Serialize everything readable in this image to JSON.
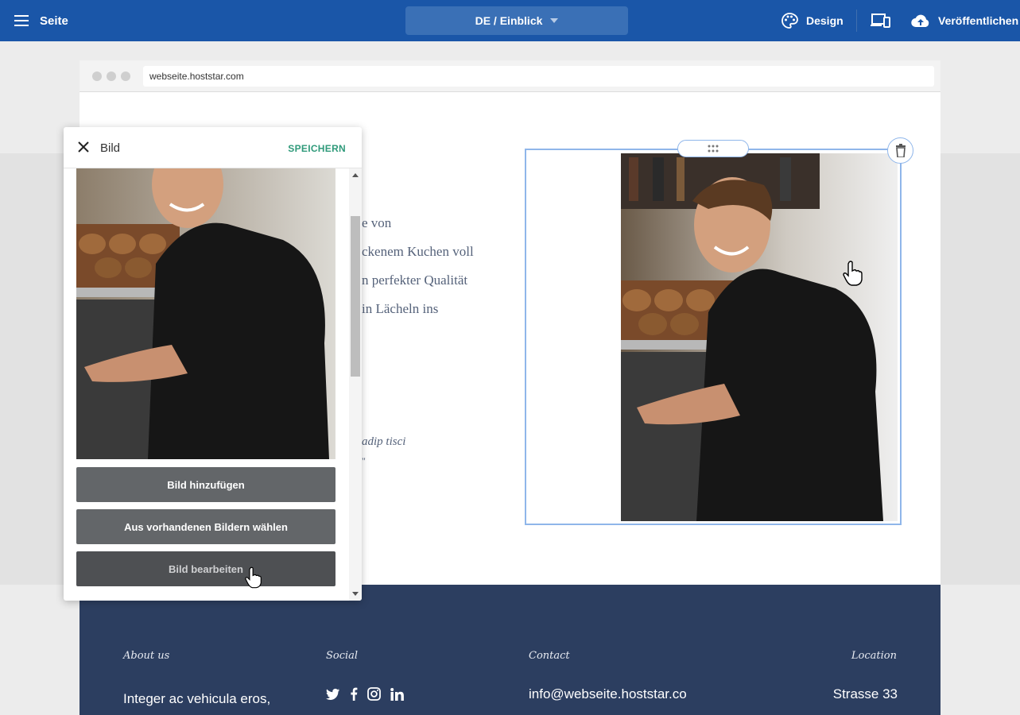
{
  "topbar": {
    "menu_label": "Seite",
    "page_select": "DE / Einblick",
    "design_label": "Design",
    "publish_label": "Veröffentlichen"
  },
  "browser": {
    "url": "webseite.hoststar.com"
  },
  "page": {
    "lines": [
      "e von",
      "ckenem Kuchen voll",
      "n perfekter Qualität",
      "in Lächeln ins"
    ],
    "italic": "adip tisci",
    "quote_mark": "\""
  },
  "panel": {
    "title": "Bild",
    "save_label": "SPEICHERN",
    "buttons": [
      "Bild hinzufügen",
      "Aus vorhandenen Bildern wählen",
      "Bild bearbeiten"
    ]
  },
  "footer": {
    "about_title": "About us",
    "about_text": "Integer ac vehicula eros,",
    "social_title": "Social",
    "contact_title": "Contact",
    "contact_email": "info@webseite.hoststar.co",
    "location_title": "Location",
    "location_text": "Strasse 33"
  },
  "colors": {
    "topbar": "#1a56a8",
    "footer": "#2c3e60",
    "accent_save": "#2f9a7a",
    "selection": "#8fb6ea"
  }
}
